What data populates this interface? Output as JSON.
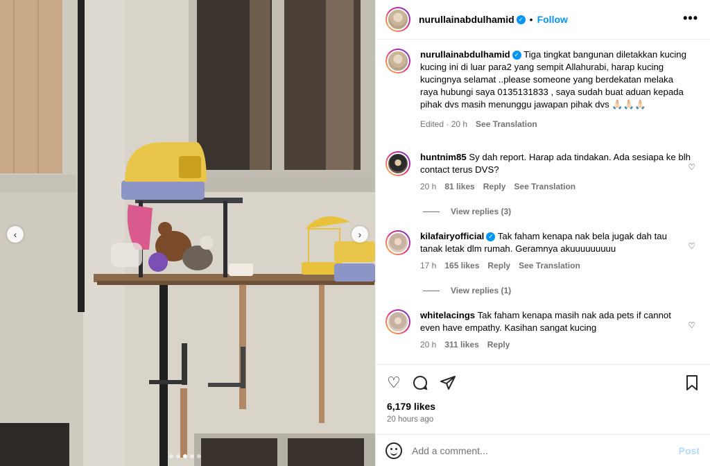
{
  "post": {
    "author": "nurullainabdulhamid",
    "follow_label": "Follow",
    "separator": "•",
    "more_icon": "more-horizontal-icon",
    "caption": "Tiga tingkat bangunan diletakkan kucing kucing ini di luar para2 yang sempit Allahurabi, harap kucing kucingnya selamat ..please someone yang berdekatan melaka raya hubungi saya 0135131833 , saya sudah buat aduan kepada pihak dvs masih menunggu jawapan pihak dvs 🙏🏻🙏🏻🙏🏻",
    "caption_edited": "Edited · 20 h",
    "see_translation": "See Translation",
    "likes": "6,179 likes",
    "time_ago": "20 hours ago"
  },
  "comments": [
    {
      "user": "huntnim85",
      "verified": false,
      "text": "Sy dah report. Harap ada tindakan. Ada sesiapa ke blh contact terus DVS?",
      "age": "20 h",
      "likes": "81 likes",
      "reply": "Reply",
      "translate": "See Translation",
      "replies": "View replies (3)"
    },
    {
      "user": "kilafairyofficial",
      "verified": true,
      "text": "Tak faham kenapa nak bela jugak dah tau tanak letak dlm rumah. Geramnya akuuuuuuuuu",
      "age": "17 h",
      "likes": "165 likes",
      "reply": "Reply",
      "translate": "See Translation",
      "replies": "View replies (1)"
    },
    {
      "user": "whitelacings",
      "verified": false,
      "text": "Tak faham kenapa masih nak ada pets if cannot even have empathy. Kasihan sangat kucing",
      "age": "20 h",
      "likes": "311 likes",
      "reply": "Reply"
    }
  ],
  "add_comment": {
    "placeholder": "Add a comment...",
    "post_label": "Post"
  },
  "carousel": {
    "prev": "‹",
    "next": "›",
    "slides": 5,
    "active": 2
  },
  "colors": {
    "accent": "#0095f6",
    "muted": "#737373",
    "post_disabled": "#b3dbff"
  }
}
